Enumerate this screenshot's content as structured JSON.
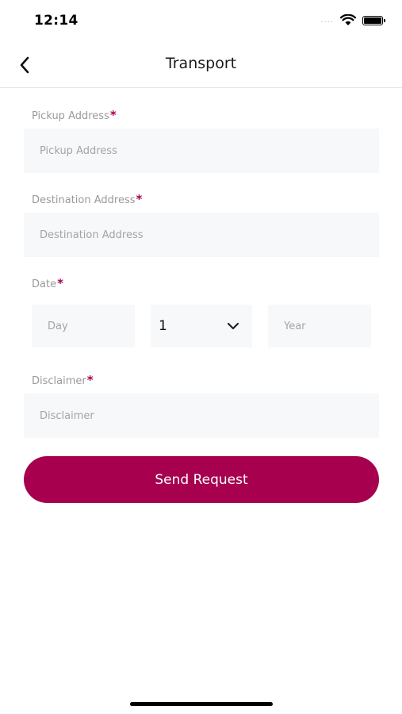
{
  "status_bar": {
    "time": "12:14",
    "signal": "....",
    "icons": [
      "wifi-icon",
      "battery-icon"
    ]
  },
  "nav": {
    "title": "Transport",
    "back_icon": "chevron-left-icon"
  },
  "form": {
    "pickup": {
      "label": "Pickup Address",
      "required_mark": "*",
      "placeholder": "Pickup Address",
      "value": ""
    },
    "destination": {
      "label": "Destination Address",
      "required_mark": "*",
      "placeholder": "Destination Address",
      "value": ""
    },
    "date": {
      "label": "Date",
      "required_mark": "*",
      "day_placeholder": "Day",
      "month_value": "1",
      "year_placeholder": "Year",
      "dropdown_icon": "chevron-down-icon"
    },
    "disclaimer": {
      "label": "Disclaimer",
      "required_mark": "*",
      "placeholder": "Disclaimer",
      "value": ""
    }
  },
  "actions": {
    "send_label": "Send Request"
  },
  "colors": {
    "accent": "#a6004f",
    "input_bg": "#f6f8f9",
    "label": "#9a9a9a",
    "placeholder": "#a4a4a4"
  }
}
